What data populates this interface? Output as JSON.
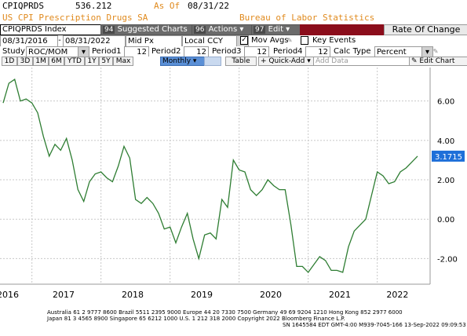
{
  "header": {
    "ticker": "CPIQPRDS",
    "last_value": "536.212",
    "asof_label": "As Of",
    "asof_date": "08/31/22",
    "description": "US CPI Prescription Drugs SA",
    "source": "Bureau of Labor Statistics"
  },
  "toolbar": {
    "index_name": "CPIQPRDS Index",
    "suggested_num": "94",
    "suggested_label": "Suggested Charts",
    "actions_num": "96",
    "actions_label": "Actions ▾",
    "edit_num": "97",
    "edit_label": "Edit ▾",
    "title_label": "Rate Of Change"
  },
  "params": {
    "date_from": "08/31/2016",
    "date_to": "08/31/2022",
    "price_field": "Mid Px",
    "currency": "Local CCY",
    "mov_avgs_label": "Mov Avgs",
    "key_events_label": "Key Events"
  },
  "study": {
    "study_label": "Study",
    "study_value": "ROC/MOM",
    "period1_label": "Period1",
    "period1_value": "12",
    "period2_label": "Period2",
    "period2_value": "12",
    "period3_label": "Period3",
    "period3_value": "12",
    "period4_label": "Period4",
    "period4_value": "12",
    "calc_type_label": "Calc Type",
    "calc_type_value": "Percent"
  },
  "range_bar": {
    "buttons": [
      "1D",
      "3D",
      "1M",
      "6M",
      "YTD",
      "1Y",
      "5Y",
      "Max"
    ],
    "frequency": "Monthly ▾",
    "table_label": "Table",
    "quick_add_label": "Quick-Add ▾",
    "add_data_label": "Add Data",
    "edit_chart_label": "Edit Chart"
  },
  "chart_data": {
    "type": "line",
    "title": "",
    "xlabel": "",
    "ylabel": "",
    "x": [
      "2016-08",
      "2016-09",
      "2016-10",
      "2016-11",
      "2016-12",
      "2017-01",
      "2017-02",
      "2017-03",
      "2017-04",
      "2017-05",
      "2017-06",
      "2017-07",
      "2017-08",
      "2017-09",
      "2017-10",
      "2017-11",
      "2017-12",
      "2018-01",
      "2018-02",
      "2018-03",
      "2018-04",
      "2018-05",
      "2018-06",
      "2018-07",
      "2018-08",
      "2018-09",
      "2018-10",
      "2018-11",
      "2018-12",
      "2019-01",
      "2019-02",
      "2019-03",
      "2019-04",
      "2019-05",
      "2019-06",
      "2019-07",
      "2019-08",
      "2019-09",
      "2019-10",
      "2019-11",
      "2019-12",
      "2020-01",
      "2020-02",
      "2020-03",
      "2020-04",
      "2020-05",
      "2020-06",
      "2020-07",
      "2020-08",
      "2020-09",
      "2020-10",
      "2020-11",
      "2020-12",
      "2021-01",
      "2021-02",
      "2021-03",
      "2021-04",
      "2021-05",
      "2021-06",
      "2021-07",
      "2021-08",
      "2021-09",
      "2021-10",
      "2021-11",
      "2021-12",
      "2022-01",
      "2022-02",
      "2022-03",
      "2022-04",
      "2022-05",
      "2022-06",
      "2022-07",
      "2022-08"
    ],
    "series": [
      {
        "values": [
          5.9,
          6.9,
          7.1,
          6.0,
          6.1,
          5.9,
          5.4,
          4.2,
          3.2,
          3.8,
          3.5,
          4.1,
          3.0,
          1.5,
          0.9,
          1.9,
          2.3,
          2.4,
          2.1,
          1.9,
          2.7,
          3.7,
          3.1,
          1.0,
          0.8,
          1.1,
          0.8,
          0.3,
          -0.5,
          -0.4,
          -1.2,
          -0.4,
          0.3,
          -1.0,
          -2.0,
          -0.8,
          -0.7,
          -1.0,
          1.0,
          0.6,
          3.0,
          2.5,
          2.4,
          1.5,
          1.2,
          1.5,
          2.0,
          1.7,
          1.5,
          1.5,
          -0.3,
          -2.4,
          -2.4,
          -2.7,
          -2.3,
          -1.9,
          -2.1,
          -2.6,
          -2.6,
          -2.7,
          -1.4,
          -0.6,
          -0.3,
          0.0,
          1.2,
          2.4,
          2.2,
          1.8,
          1.9,
          2.4,
          2.6,
          2.9,
          3.2
        ]
      }
    ],
    "y_ticks": [
      "6.00",
      "4.00",
      "2.00",
      "0.00",
      "-2.00"
    ],
    "ylim": [
      -3.3,
      7.7
    ],
    "x_tick_labels": [
      "2016",
      "2017",
      "2018",
      "2019",
      "2020",
      "2021",
      "2022"
    ],
    "last_value_label": "3.1715",
    "grid": true,
    "line_color": "#2e7d32"
  },
  "footer": {
    "line1": "Australia 61 2 9777 8600 Brazil 5511 2395 9000 Europe 44 20 7330 7500 Germany 49 69 9204 1210 Hong Kong 852 2977 6000",
    "line2": "Japan 81 3 4565 8900       Singapore 65 6212 1000       U.S. 1 212 318 2000                 Copyright 2022 Bloomberg Finance L.P.",
    "line3": "SN 1645584 EDT  GMT-4:00 M939-7045-166 13-Sep-2022 09:09:53"
  },
  "colors": {
    "accent_red": "#8b0d1b",
    "label_box_blue": "#1e6fd9",
    "ticker_orange": "#e08a1e",
    "line_green": "#2e7d32"
  }
}
